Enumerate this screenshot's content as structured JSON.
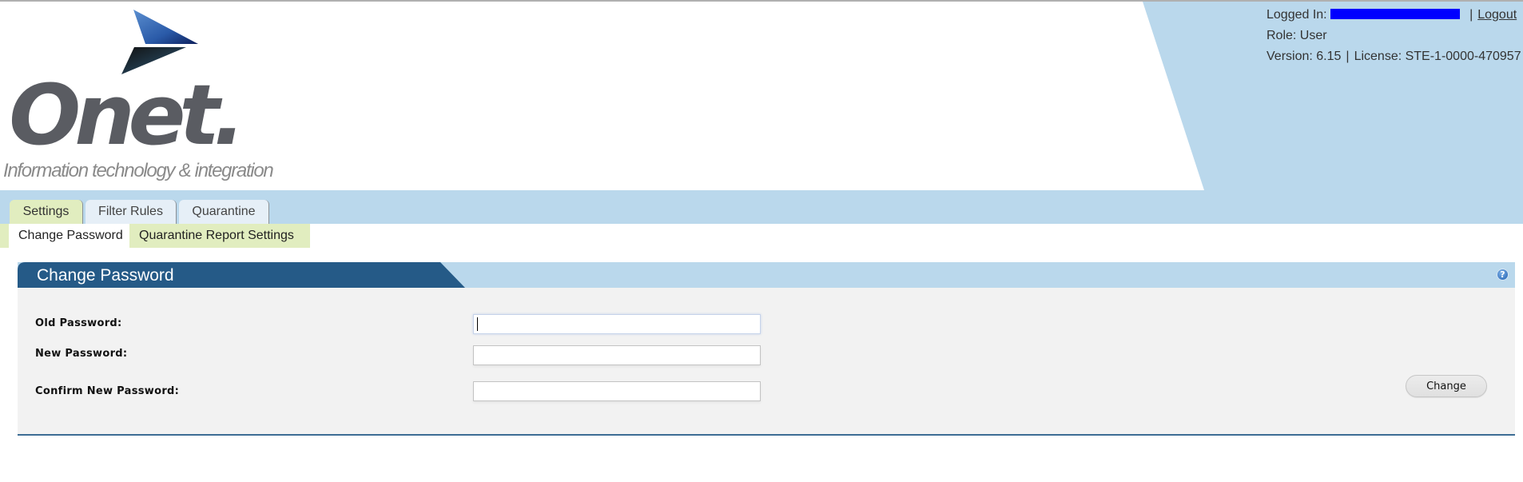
{
  "brand": {
    "name": "Onet.",
    "tagline": "Information technology & integration",
    "colors": {
      "header_blue": "#bad8ec",
      "panel_header_dark": "#255a87",
      "tab_active": "#e1edbf",
      "tab_inactive": "#e6eff7"
    }
  },
  "user_info": {
    "logged_in_label": "Logged In:",
    "logged_in_value": "[redacted]",
    "separator": "|",
    "logout_label": "Logout",
    "role_text": "Role: User",
    "version_text": "Version: 6.15",
    "license_text": "License: STE-1-0000-470957"
  },
  "tabs": [
    {
      "label": "Settings",
      "active": true
    },
    {
      "label": "Filter Rules",
      "active": false
    },
    {
      "label": "Quarantine",
      "active": false
    }
  ],
  "subnav": [
    {
      "label": "Change Password",
      "active": true
    },
    {
      "label": "Quarantine Report Settings",
      "active": false
    }
  ],
  "panel": {
    "title": "Change Password",
    "help_icon": "question-circle-icon",
    "help_glyph": "?",
    "fields": [
      {
        "label": "Old Password:",
        "value": "",
        "focused": true
      },
      {
        "label": "New Password:",
        "value": "",
        "focused": false
      },
      {
        "label": "Confirm New Password:",
        "value": "",
        "focused": false
      }
    ],
    "submit_label": "Change"
  }
}
